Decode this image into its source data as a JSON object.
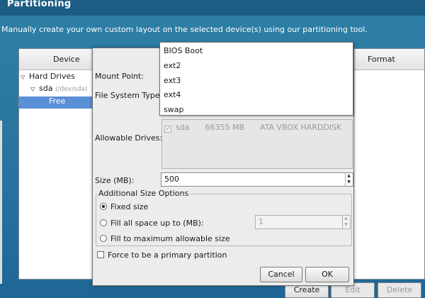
{
  "page": {
    "title": "Partitioning",
    "subtitle": "Manually create your own custom layout on the selected device(s) using our partitioning tool."
  },
  "tree": {
    "columns": [
      "Device",
      "Format"
    ],
    "items": [
      {
        "label": "Hard Drives"
      },
      {
        "label": "sda",
        "sublabel": "(/dev/sda)"
      },
      {
        "label": "Free"
      }
    ]
  },
  "main_buttons": {
    "create": "Create",
    "edit": "Edit",
    "delete": "Delete"
  },
  "dialog": {
    "mount_point_label": "Mount Point:",
    "fs_type_label": "File System Type:",
    "allowable_drives_label": "Allowable Drives:",
    "drives": [
      {
        "checked": true,
        "name": "sda",
        "size": "66355 MB",
        "model": "ATA VBOX HARDDISK"
      }
    ],
    "size_label": "Size (MB):",
    "size_value": "500",
    "additional_size_title": "Additional Size Options",
    "size_options": [
      {
        "label": "Fixed size",
        "selected": true
      },
      {
        "label": "Fill all space up to (MB):",
        "selected": false
      },
      {
        "label": "Fill to maximum allowable size",
        "selected": false
      }
    ],
    "fill_up_to_value": "1",
    "primary_partition_label": "Force to be a primary partition",
    "primary_partition_checked": false,
    "cancel_label": "Cancel",
    "ok_label": "OK"
  },
  "fs_dropdown": {
    "options": [
      "BIOS Boot",
      "ext2",
      "ext3",
      "ext4",
      "swap"
    ]
  },
  "icons": {
    "expander": "triangle-down-icon",
    "checkbox": "check-icon",
    "spin": "spin-arrows-icon"
  },
  "colors": {
    "background": "#2a78a0",
    "selection": "#5b8fd6",
    "dialog": "#ececec"
  }
}
